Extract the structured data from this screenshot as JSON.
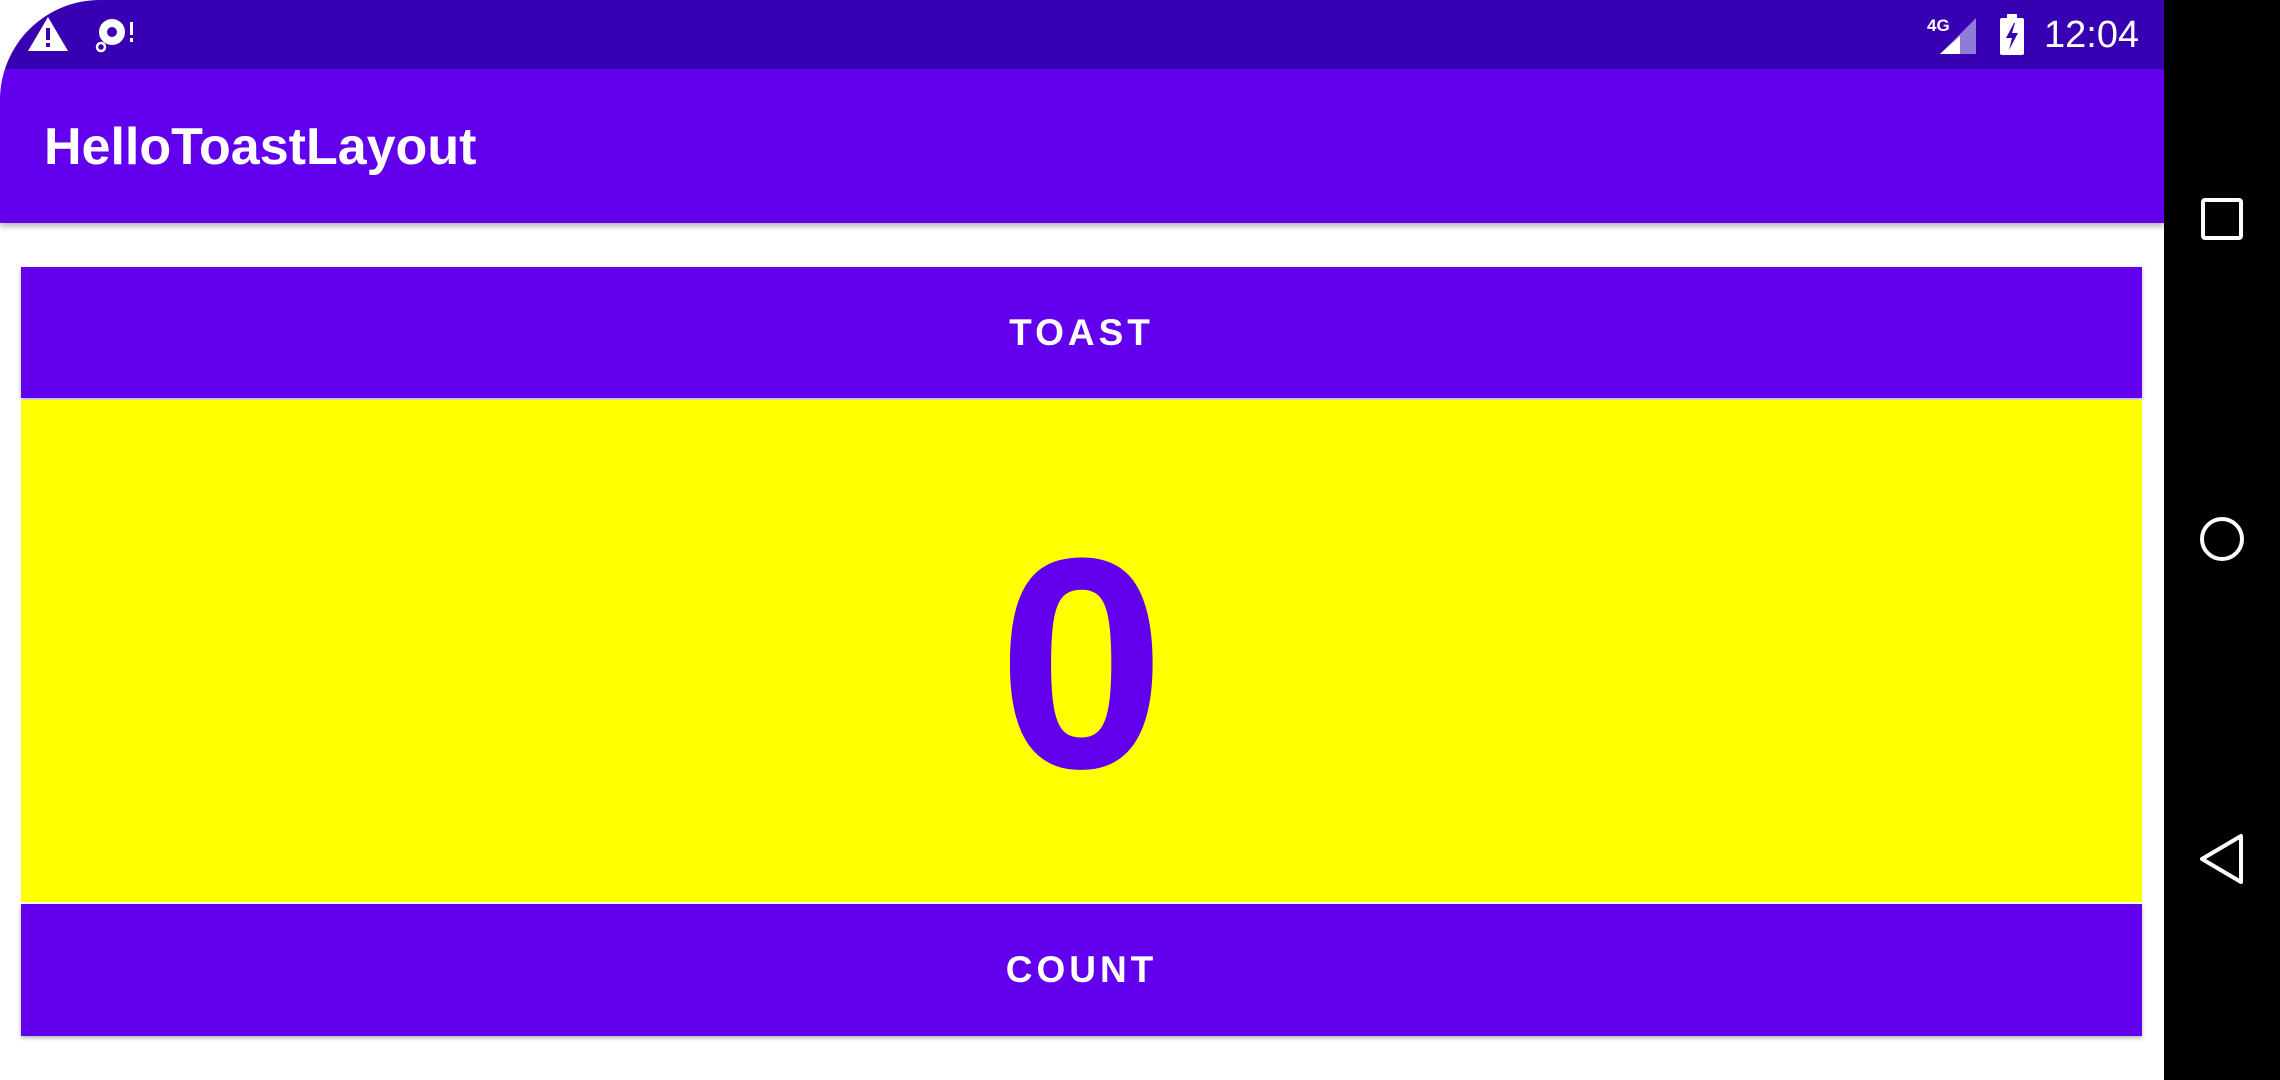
{
  "status_bar": {
    "time": "12:04",
    "network": "4G",
    "icons": [
      "warning-icon",
      "sync-error-icon",
      "signal-icon",
      "battery-charging-icon"
    ]
  },
  "app_bar": {
    "title": "HelloToastLayout"
  },
  "main": {
    "toast_button_label": "TOAST",
    "count_value": "0",
    "count_button_label": "COUNT"
  },
  "nav_bar": {
    "icons": [
      "recents-icon",
      "home-icon",
      "back-icon"
    ]
  },
  "colors": {
    "primary": "#6200EE",
    "primary_dark": "#3700B3",
    "count_background": "#FFFF00",
    "on_primary": "#FFFFFF"
  }
}
